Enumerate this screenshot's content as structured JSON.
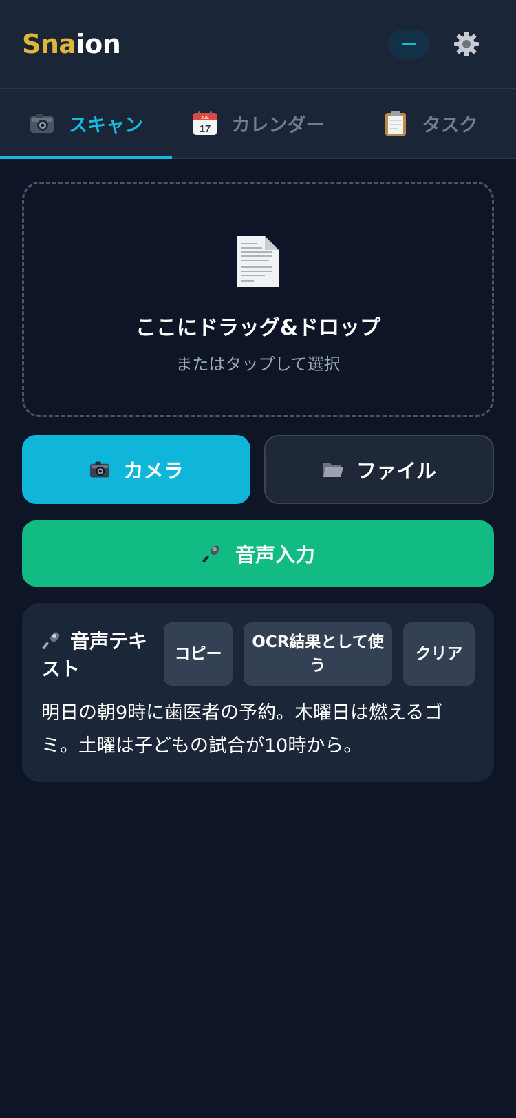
{
  "header": {
    "logo_accent": "Sna",
    "logo_rest": "ion",
    "status_indicator": "–"
  },
  "tabs": [
    {
      "label": "スキャン",
      "icon": "camera-icon",
      "active": true
    },
    {
      "label": "カレンダー",
      "icon": "calendar-icon",
      "active": false
    },
    {
      "label": "タスク",
      "icon": "clipboard-icon",
      "active": false
    }
  ],
  "calendar_icon_text": {
    "month": "JUL",
    "day": "17"
  },
  "dropzone": {
    "title": "ここにドラッグ&ドロップ",
    "subtitle": "またはタップして選択",
    "icon": "document-icon"
  },
  "buttons": {
    "camera": "カメラ",
    "file": "ファイル",
    "voice": "音声入力"
  },
  "voice_card": {
    "title": "音声テキスト",
    "copy_label": "コピー",
    "ocr_label": "OCR結果として使う",
    "clear_label": "クリア",
    "text": "明日の朝9時に歯医者の予約。木曜日は燃えるゴミ。土曜は子どもの試合が10時から。"
  },
  "colors": {
    "accent": "#19b8dd",
    "logo_gold": "#e0b637",
    "voice_green": "#12bb83",
    "background": "#0d1526"
  }
}
